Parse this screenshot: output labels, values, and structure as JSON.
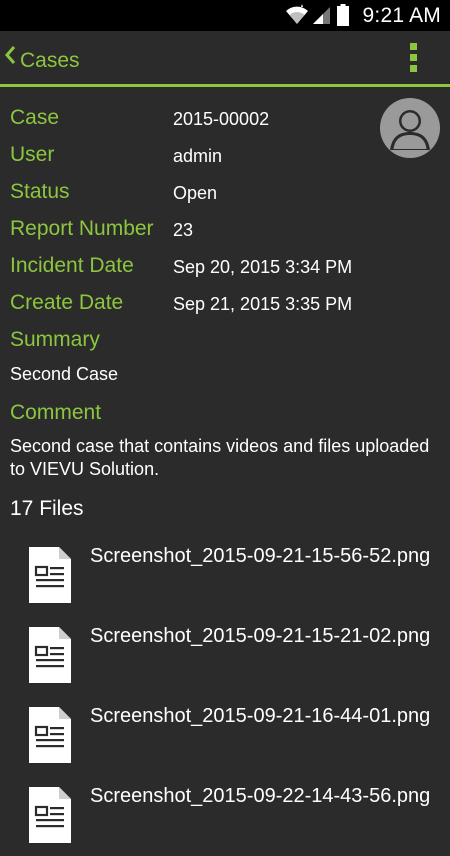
{
  "status_bar": {
    "time": "9:21 AM"
  },
  "action_bar": {
    "title": "Cases"
  },
  "details": [
    {
      "label": "Case",
      "value": "2015-00002"
    },
    {
      "label": "User",
      "value": "admin"
    },
    {
      "label": "Status",
      "value": "Open"
    },
    {
      "label": "Report Number",
      "value": "23"
    },
    {
      "label": "Incident Date",
      "value": "Sep 20, 2015 3:34 PM"
    },
    {
      "label": "Create Date",
      "value": "Sep 21, 2015 3:35 PM"
    }
  ],
  "summary": {
    "label": "Summary",
    "text": "Second Case"
  },
  "comment": {
    "label": "Comment",
    "text": "Second case that contains videos and files uploaded to VIEVU Solution."
  },
  "files": {
    "count_label": "17 Files",
    "items": [
      {
        "name": "Screenshot_2015-09-21-15-56-52.png"
      },
      {
        "name": "Screenshot_2015-09-21-15-21-02.png"
      },
      {
        "name": "Screenshot_2015-09-21-16-44-01.png"
      },
      {
        "name": "Screenshot_2015-09-22-14-43-56.png"
      }
    ]
  },
  "colors": {
    "accent": "#8cc63f",
    "background": "#2b2b2b",
    "status_bar": "#000000",
    "text": "#ffffff"
  }
}
